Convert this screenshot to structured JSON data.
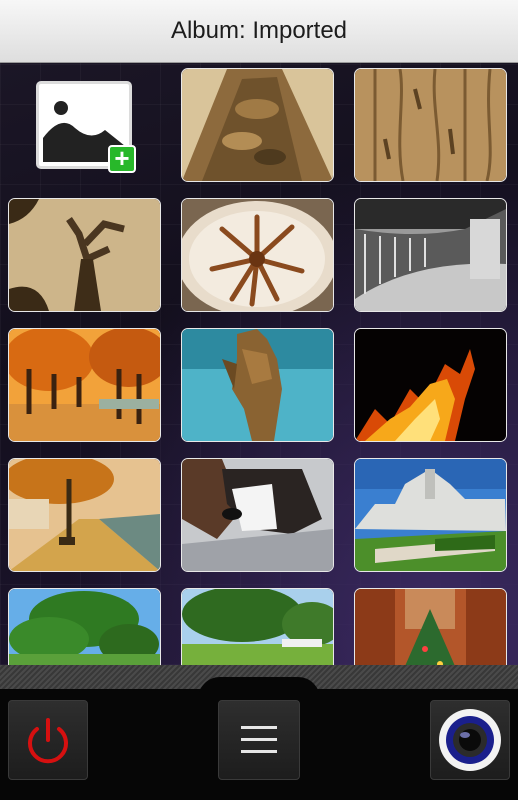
{
  "header": {
    "title": "Album: Imported"
  },
  "add_tile": {
    "icon": "add-photo-icon",
    "accent": "#28b82a"
  },
  "photos": [
    {
      "id": "tree-bark-closeup",
      "tone": "sepia"
    },
    {
      "id": "wood-texture",
      "tone": "sepia"
    },
    {
      "id": "dead-tree",
      "tone": "sepia"
    },
    {
      "id": "latte-art",
      "tone": "sepia"
    },
    {
      "id": "curved-corridor",
      "tone": "grayscale"
    },
    {
      "id": "autumn-alley",
      "tone": "color"
    },
    {
      "id": "stone-statue",
      "tone": "color"
    },
    {
      "id": "fire-flames",
      "tone": "color"
    },
    {
      "id": "autumn-river-path",
      "tone": "color"
    },
    {
      "id": "dog-portrait",
      "tone": "color"
    },
    {
      "id": "white-castle",
      "tone": "color"
    },
    {
      "id": "green-tree",
      "tone": "color"
    },
    {
      "id": "park-trees",
      "tone": "color"
    },
    {
      "id": "christmas-tree",
      "tone": "color"
    }
  ],
  "toolbar": {
    "power": {
      "icon": "power-icon",
      "color": "#d61010"
    },
    "menu": {
      "icon": "menu-icon"
    },
    "camera": {
      "icon": "camera-lens-icon",
      "color": "#1a1f8c"
    }
  }
}
